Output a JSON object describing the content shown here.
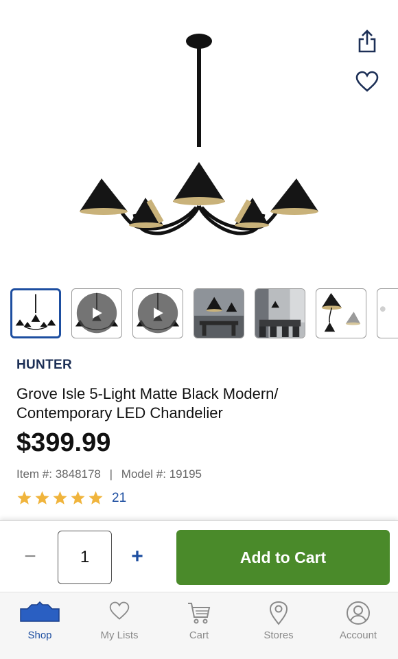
{
  "product": {
    "brand": "HUNTER",
    "title": "Grove Isle 5-Light Matte Black Modern/ Contemporary LED Chandelier",
    "price": "$399.99",
    "item_label": "Item #:",
    "item_number": "3848178",
    "model_label": "Model #:",
    "model_number": "19195",
    "rating": 5,
    "review_count": "21"
  },
  "gallery": {
    "thumbnails": [
      {
        "kind": "image",
        "selected": true
      },
      {
        "kind": "video"
      },
      {
        "kind": "video"
      },
      {
        "kind": "image"
      },
      {
        "kind": "image"
      },
      {
        "kind": "image"
      },
      {
        "kind": "image"
      }
    ]
  },
  "cart": {
    "quantity": "1",
    "minus_symbol": "−",
    "plus_symbol": "+",
    "add_label": "Add to Cart"
  },
  "tabs": [
    {
      "label": "Shop",
      "icon": "shop-icon",
      "active": true
    },
    {
      "label": "My Lists",
      "icon": "heart-icon"
    },
    {
      "label": "Cart",
      "icon": "cart-icon"
    },
    {
      "label": "Stores",
      "icon": "location-pin-icon"
    },
    {
      "label": "Account",
      "icon": "account-icon"
    }
  ],
  "colors": {
    "accent_blue": "#1d4ea0",
    "brand_navy": "#1c2f56",
    "add_to_cart_green": "#4a8a2a",
    "star_gold": "#f0b43c"
  }
}
